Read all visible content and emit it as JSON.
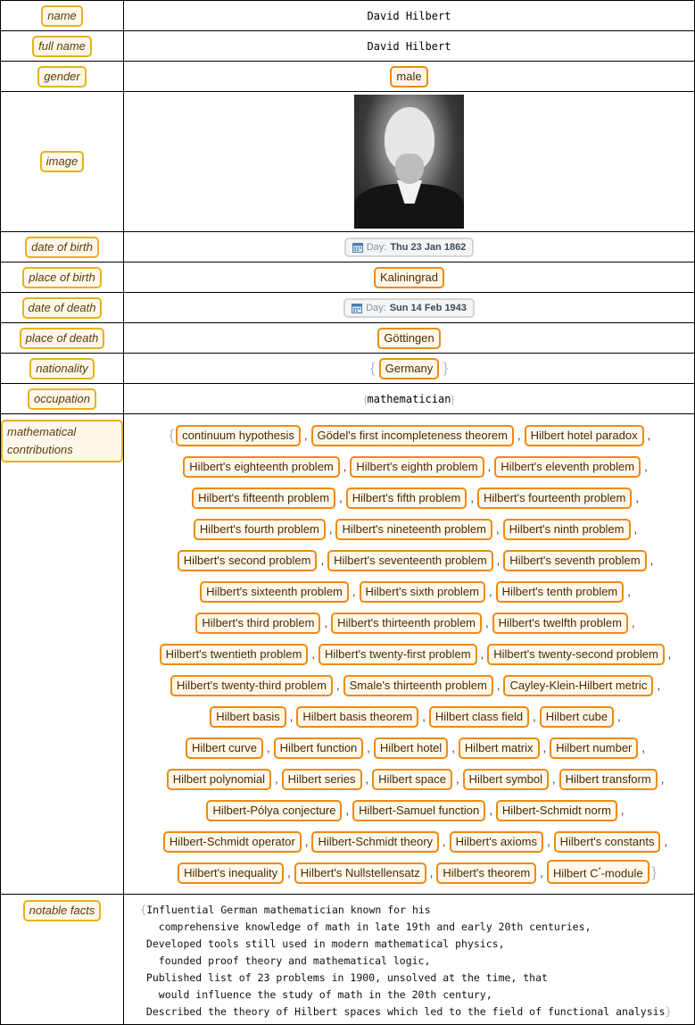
{
  "rows": {
    "name": {
      "key": "name",
      "value": "David Hilbert"
    },
    "full_name": {
      "key": "full name",
      "value": "David Hilbert"
    },
    "gender": {
      "key": "gender",
      "value": "male"
    },
    "image": {
      "key": "image",
      "alt": "Portrait photograph of David Hilbert"
    },
    "date_of_birth": {
      "key": "date of birth",
      "label": "Day:",
      "value": "Thu 23 Jan 1862"
    },
    "place_of_birth": {
      "key": "place of birth",
      "value": "Kaliningrad"
    },
    "date_of_death": {
      "key": "date of death",
      "label": "Day:",
      "value": "Sun 14 Feb 1943"
    },
    "place_of_death": {
      "key": "place of death",
      "value": "Göttingen"
    },
    "nationality": {
      "key": "nationality",
      "value": "Germany"
    },
    "occupation": {
      "key": "occupation",
      "value": "mathematician"
    },
    "contributions": {
      "key": "mathematical contributions",
      "items": [
        "continuum hypothesis",
        "Gödel's first incompleteness theorem",
        "Hilbert hotel paradox",
        "Hilbert's eighteenth problem",
        "Hilbert's eighth problem",
        "Hilbert's eleventh problem",
        "Hilbert's fifteenth problem",
        "Hilbert's fifth problem",
        "Hilbert's fourteenth problem",
        "Hilbert's fourth problem",
        "Hilbert's nineteenth problem",
        "Hilbert's ninth problem",
        "Hilbert's second problem",
        "Hilbert's seventeenth problem",
        "Hilbert's seventh problem",
        "Hilbert's sixteenth problem",
        "Hilbert's sixth problem",
        "Hilbert's tenth problem",
        "Hilbert's third problem",
        "Hilbert's thirteenth problem",
        "Hilbert's twelfth problem",
        "Hilbert's twentieth problem",
        "Hilbert's twenty-first problem",
        "Hilbert's twenty-second problem",
        "Hilbert's twenty-third problem",
        "Smale's thirteenth problem",
        "Cayley-Klein-Hilbert metric",
        "Hilbert basis",
        "Hilbert basis theorem",
        "Hilbert class field",
        "Hilbert cube",
        "Hilbert curve",
        "Hilbert function",
        "Hilbert hotel",
        "Hilbert matrix",
        "Hilbert number",
        "Hilbert polynomial",
        "Hilbert series",
        "Hilbert space",
        "Hilbert symbol",
        "Hilbert transform",
        "Hilbert-Pólya conjecture",
        "Hilbert-Samuel function",
        "Hilbert-Schmidt norm",
        "Hilbert-Schmidt operator",
        "Hilbert-Schmidt theory",
        "Hilbert's axioms",
        "Hilbert's constants",
        "Hilbert's inequality",
        "Hilbert's Nullstellensatz",
        "Hilbert's theorem",
        "Hilbert C*-module"
      ],
      "line_breaks_after": [
        2,
        5,
        8,
        11,
        14,
        17,
        20,
        23,
        26,
        30,
        35,
        40,
        43,
        47
      ]
    },
    "notable_facts": {
      "key": "notable facts",
      "lines": [
        "Influential German mathematician known for his",
        "  comprehensive knowledge of math in late 19th and early 20th centuries,",
        "Developed tools still used in modern mathematical physics,",
        "  founded proof theory and mathematical logic,",
        "Published list of 23 problems in 1900, unsolved at the time, that",
        "  would influence the study of math in the 20th century,",
        "Described the theory of Hilbert spaces which led to the field of functional analysis"
      ]
    }
  },
  "colors": {
    "key_border": "#e6b21a",
    "entity_border": "#f08a10",
    "chip_background": "#fff8ea",
    "brace": "#a9b6c8"
  }
}
